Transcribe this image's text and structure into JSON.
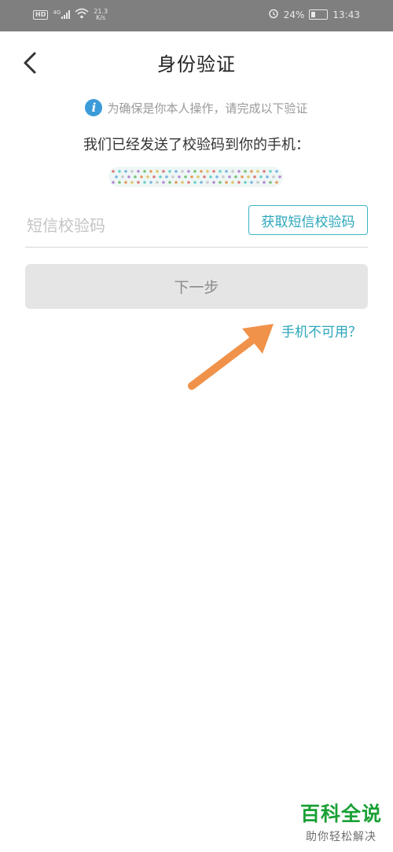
{
  "status_bar": {
    "hd_badge": "HD",
    "network_type": "4G",
    "net_speed_value": "21.3",
    "net_speed_unit": "K/s",
    "battery_percent": "24%",
    "time": "13:43"
  },
  "header": {
    "title": "身份验证"
  },
  "notice": {
    "icon_label": "i",
    "text": "为确保是你本人操作，请完成以下验证"
  },
  "sent_message": "我们已经发送了校验码到你的手机：",
  "code_input": {
    "placeholder": "短信校验码",
    "value": ""
  },
  "get_code_button": "获取短信校验码",
  "next_button": "下一步",
  "phone_unavailable_link": "手机不可用？",
  "watermark": {
    "title": "百科全说",
    "subtitle": "助你轻松解决"
  },
  "colors": {
    "status_bar_bg": "#7f7f7f",
    "accent": "#2aa6bb",
    "info_icon": "#3b9bd9",
    "arrow": "#f0924a",
    "watermark_green": "#1aa035"
  }
}
